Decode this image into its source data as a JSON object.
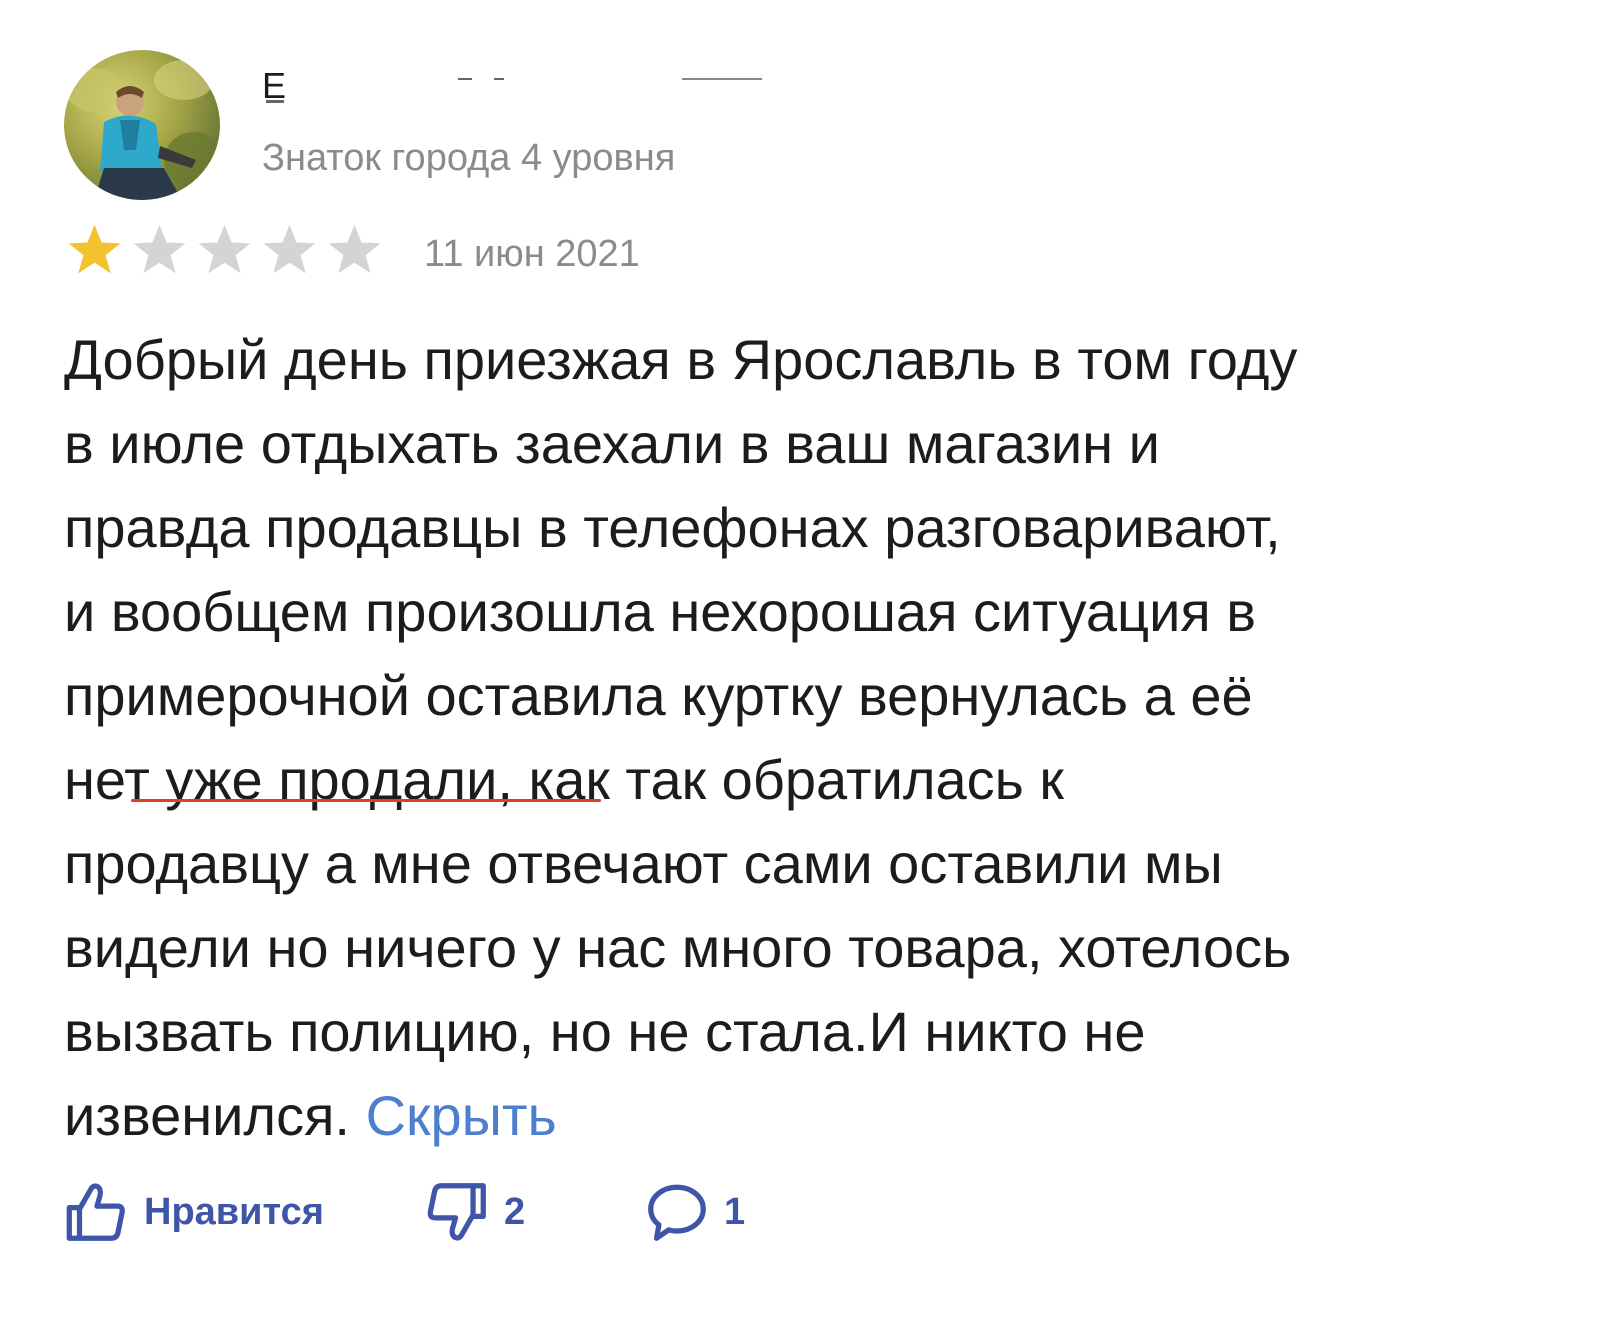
{
  "author": {
    "name_visible": "Е",
    "level": "Знаток города 4 уровня"
  },
  "rating": {
    "value": 1,
    "max": 5,
    "filled_color": "#f2c230",
    "empty_color": "#d4d4d4"
  },
  "date": "11 июн 2021",
  "review": {
    "lines": [
      "Добрый день приезжая в Ярославль в том году",
      "в июле отдыхать заехали в ваш магазин и",
      "правда продавцы в телефонах разговаривают,",
      "и вообщем произошла нехорошая ситуация в",
      "примерочной оставила куртку вернулась а её",
      "нет уже продали, как так обратилась к",
      "продавцу а мне отвечают сами оставили мы",
      "видели но ничего у нас много товара, хотелось",
      "вызвать полицию, но не стала.И никто не",
      "извенился."
    ],
    "hide_link": "Скрыть",
    "underline_color": "#d9412b",
    "link_color": "#4c7fd0"
  },
  "actions": {
    "like_label": "Нравится",
    "dislike_count": "2",
    "comment_count": "1",
    "icon_color": "#3f56a8",
    "icons": [
      "thumbs-up-icon",
      "thumbs-down-icon",
      "comment-icon"
    ]
  }
}
